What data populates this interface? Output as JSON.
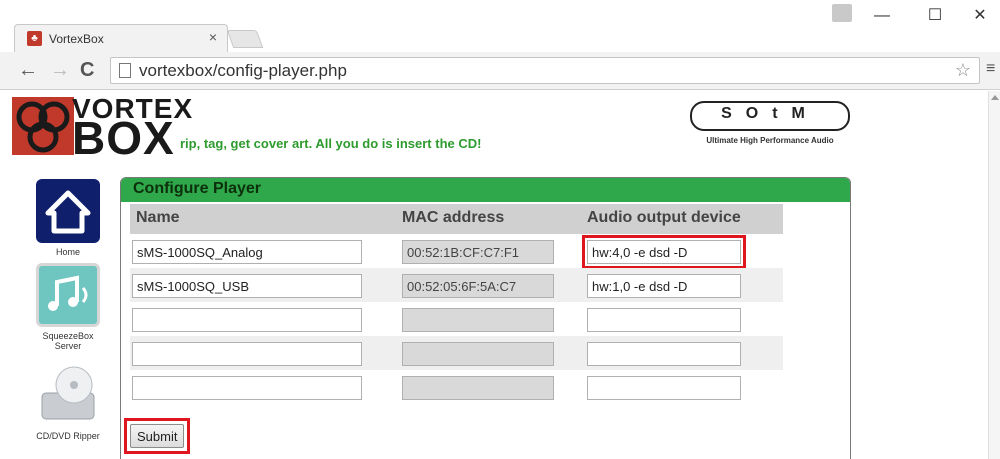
{
  "browser": {
    "tab_title": "VortexBox",
    "tab_close": "×",
    "address": "vortexbox/config-player.php",
    "window_controls": {
      "minimize": "—",
      "maximize": "☐",
      "close": "✕"
    }
  },
  "header": {
    "logo_top": "VORTEX",
    "logo_bottom": "BOX",
    "tagline": "rip, tag, get cover art. All you do is insert the CD!",
    "sotm_letters": "SOtM",
    "sotm_subtitle": "Ultimate High Performance Audio"
  },
  "sidebar": {
    "items": [
      {
        "label": "Home",
        "icon": "home-icon"
      },
      {
        "label": "SqueezeBox Server",
        "icon": "music-note-icon"
      },
      {
        "label": "CD/DVD Ripper",
        "icon": "cd-drive-icon"
      }
    ]
  },
  "panel": {
    "title": "Configure Player",
    "columns": {
      "name": "Name",
      "mac": "MAC address",
      "device": "Audio output device"
    },
    "rows": [
      {
        "name": "sMS-1000SQ_Analog",
        "mac": "00:52:1B:CF:C7:F1",
        "device": "hw:4,0 -e dsd -D"
      },
      {
        "name": "sMS-1000SQ_USB",
        "mac": "00:52:05:6F:5A:C7",
        "device": "hw:1,0 -e dsd -D"
      },
      {
        "name": "",
        "mac": "",
        "device": ""
      },
      {
        "name": "",
        "mac": "",
        "device": ""
      },
      {
        "name": "",
        "mac": "",
        "device": ""
      }
    ],
    "submit_label": "Submit"
  },
  "colors": {
    "panel_header": "#2ea84a",
    "tagline": "#2e9b2e",
    "highlight": "#e0161e",
    "logo_red": "#c0392b"
  }
}
